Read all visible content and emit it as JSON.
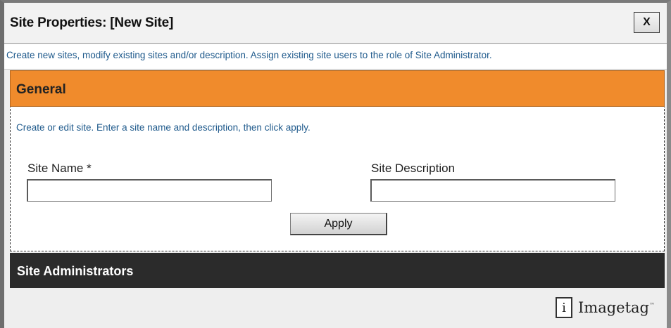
{
  "dialog": {
    "title": "Site Properties: [New Site]",
    "close_label": "X",
    "instructions": "Create new sites, modify existing sites and/or description. Assign existing site users to the role of Site Administrator."
  },
  "general": {
    "title": "General",
    "description": "Create or edit site. Enter a site name and description, then click apply.",
    "site_name_label": "Site Name *",
    "site_name_value": "",
    "site_description_label": "Site Description",
    "site_description_value": "",
    "apply_label": "Apply"
  },
  "site_administrators": {
    "title": "Site Administrators"
  },
  "branding": {
    "icon_glyph": "i",
    "name": "Imagetag",
    "trademark": "™"
  },
  "colors": {
    "general_header": "#f08b2c",
    "admins_header": "#2b2b2b",
    "instruction_text": "#1f5a8c"
  }
}
